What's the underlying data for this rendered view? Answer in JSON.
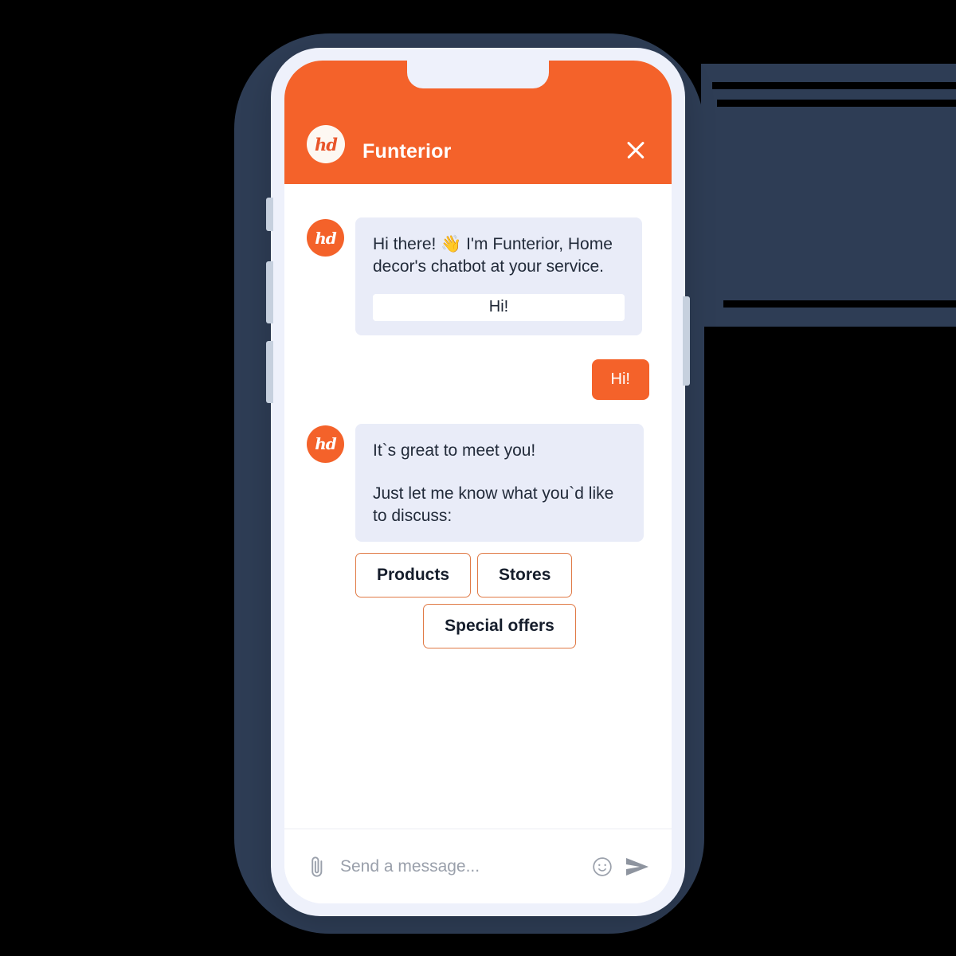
{
  "app": {
    "background_color": "#000000",
    "accent_color": "#f4622a",
    "navy_color": "#2e3d55",
    "bubble_in_color": "#e9ecf8"
  },
  "header": {
    "avatar_text": "hd",
    "title": "Funterior",
    "close_label": "Close chat"
  },
  "messages": [
    {
      "from": "bot",
      "avatar_text": "hd",
      "lines": [
        "Hi there! 👋 I'm Funterior, Home decor's chatbot at your service."
      ],
      "inline_reply": "Hi!"
    },
    {
      "from": "user",
      "text": "Hi!"
    },
    {
      "from": "bot",
      "avatar_text": "hd",
      "lines": [
        "It`s great to meet you!",
        "Just let me know what you`d like to discuss:"
      ]
    }
  ],
  "quick_replies": [
    {
      "label": "Products"
    },
    {
      "label": "Stores"
    },
    {
      "label": "Special offers"
    }
  ],
  "input_bar": {
    "placeholder": "Send a message...",
    "value": "",
    "attach_icon": "paperclip-icon",
    "emoji_icon": "smiley-icon",
    "send_icon": "send-icon"
  }
}
